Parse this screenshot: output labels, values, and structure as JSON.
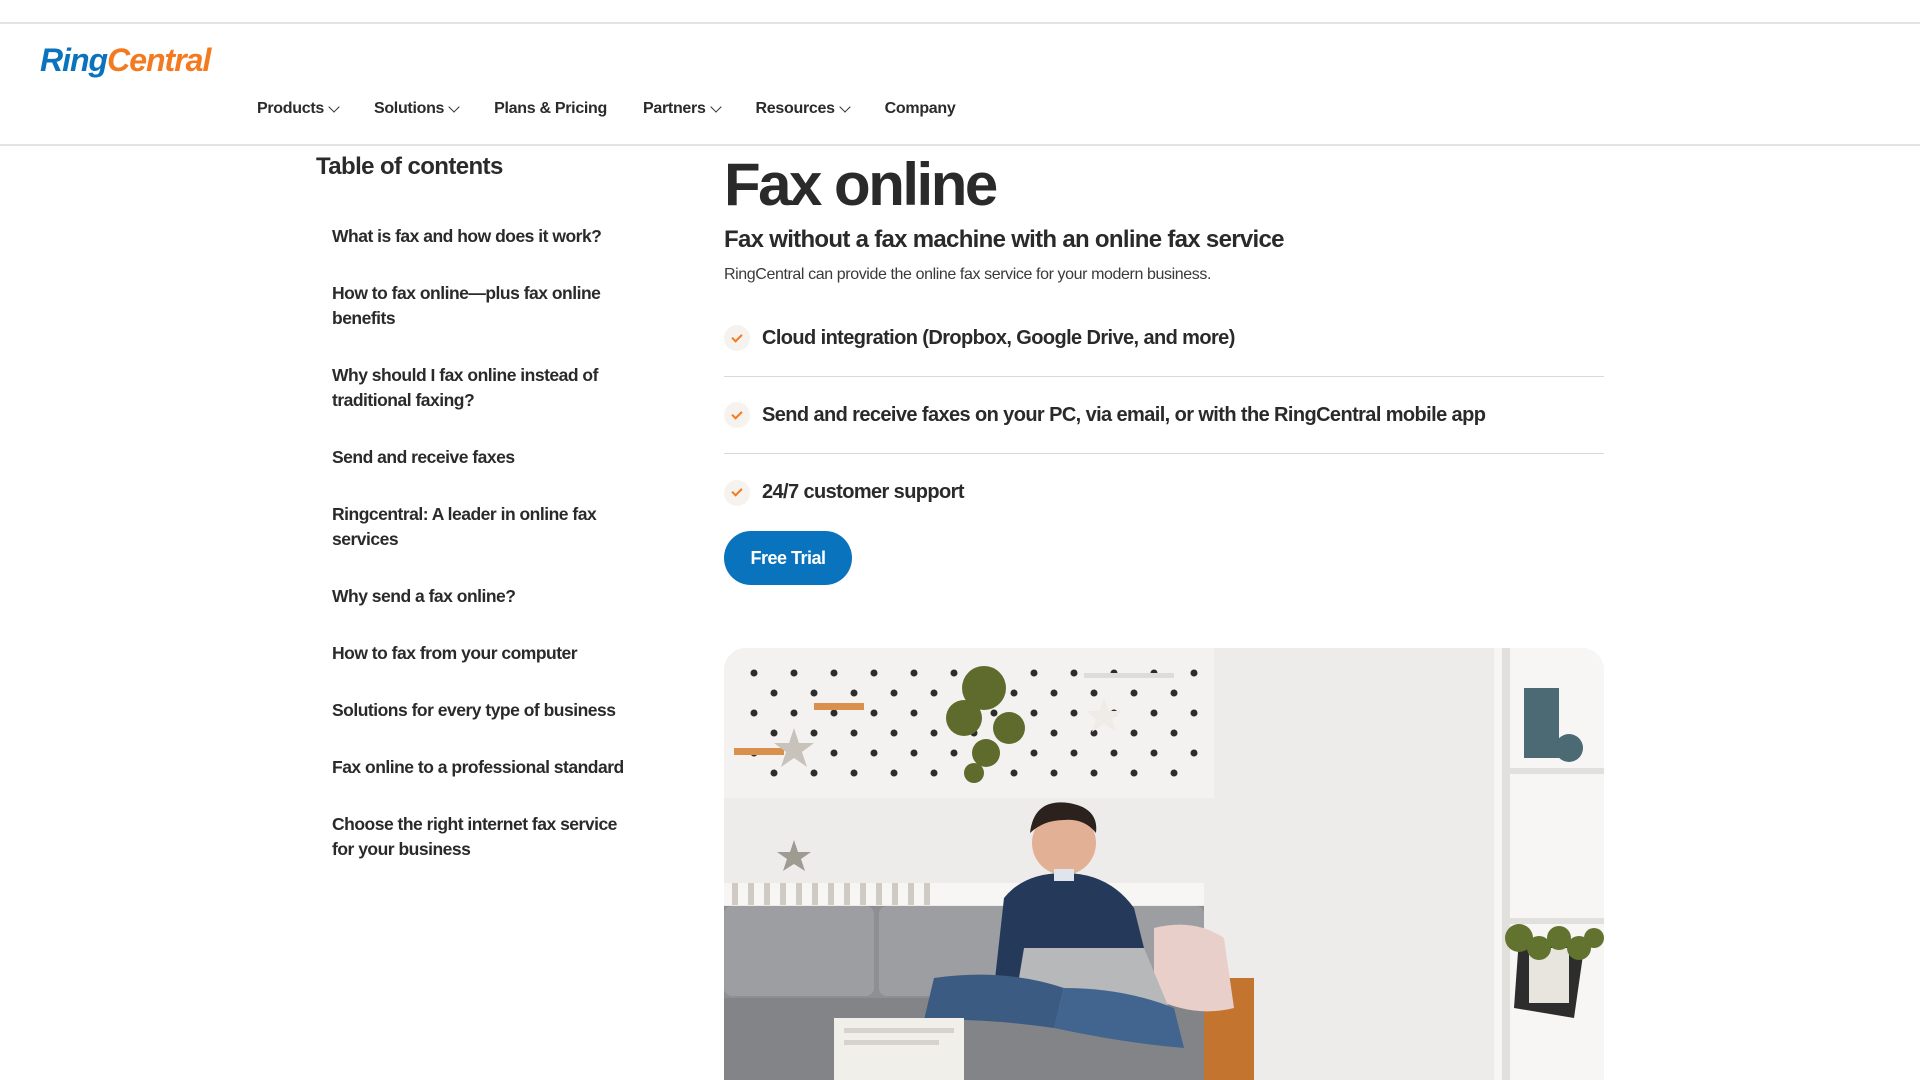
{
  "header": {
    "logo": {
      "ring": "Ring",
      "central": "Central"
    },
    "nav": [
      {
        "label": "Products",
        "has_dropdown": true
      },
      {
        "label": "Solutions",
        "has_dropdown": true
      },
      {
        "label": "Plans & Pricing",
        "has_dropdown": false
      },
      {
        "label": "Partners",
        "has_dropdown": true
      },
      {
        "label": "Resources",
        "has_dropdown": true
      },
      {
        "label": "Company",
        "has_dropdown": false
      }
    ]
  },
  "toc": {
    "title": "Table of contents",
    "items": [
      "What is fax and how does it work?",
      "How to fax online—plus fax online benefits",
      "Why should I fax online instead of traditional faxing?",
      "Send and receive faxes",
      "Ringcentral: A leader in online fax services",
      "Why send a fax online?",
      "How to fax from your computer",
      "Solutions for every type of business",
      "Fax online to a professional standard",
      "Choose the right internet fax service for your business"
    ]
  },
  "main": {
    "title": "Fax online",
    "subtitle": "Fax without a fax machine with an online fax service",
    "intro": "RingCentral can provide the online fax service for your modern business.",
    "features": [
      "Cloud integration (Dropbox, Google Drive, and more)",
      "Send and receive faxes on your PC, via email, or with the RingCentral mobile app",
      "24/7 customer support"
    ],
    "cta_label": "Free Trial"
  },
  "colors": {
    "brand_blue": "#0a73bd",
    "brand_orange": "#f47a20",
    "text": "#2a2a2a",
    "divider": "#d9d9d9"
  }
}
